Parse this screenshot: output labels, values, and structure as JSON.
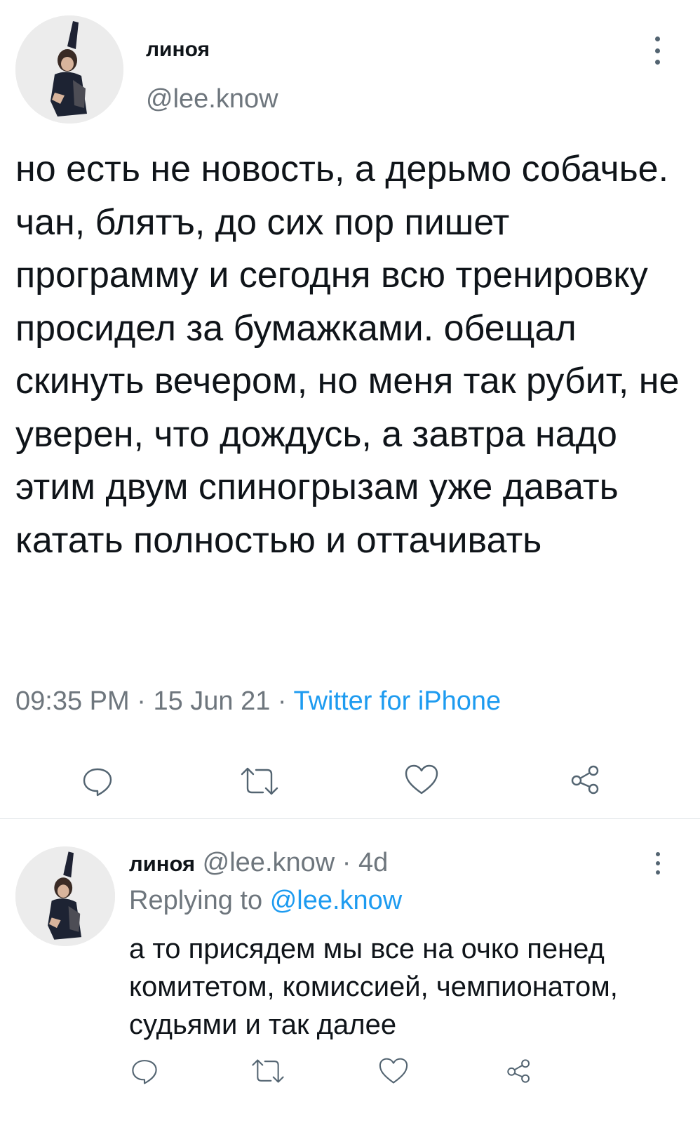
{
  "main_tweet": {
    "author_name": "линоя",
    "author_handle": "@lee.know",
    "text": "но есть не новость, а дерьмо собачье. чан, блятъ, до сих пор пишет программу и сегодня всю тренировку просидел за бумажками. обещал скинуть вечером, но меня так рубит, не уверен, что дождусь, а завтра надо этим двум спиногрызам уже давать катать полностью и оттачивать",
    "time": "09:35 PM",
    "date": "15 Jun 21",
    "separator": "·",
    "source": "Twitter for iPhone",
    "actions": [
      "reply-icon",
      "retweet-icon",
      "like-icon",
      "share-icon"
    ]
  },
  "reply_tweet": {
    "author_name": "линоя",
    "author_handle": "@lee.know",
    "separator": "·",
    "age": "4d",
    "replying_prefix": "Replying to",
    "replying_to": "@lee.know",
    "text": "а то присядем мы все на очко пенед комитетом, комиссией, чемпионатом, судьями и так далее",
    "actions": [
      "reply-icon",
      "retweet-icon",
      "like-icon",
      "share-icon"
    ]
  },
  "colors": {
    "text": "#0f1419",
    "secondary": "#6e767d",
    "link": "#1d9bf0",
    "icon": "#536471",
    "divider": "#e1e5e8"
  }
}
